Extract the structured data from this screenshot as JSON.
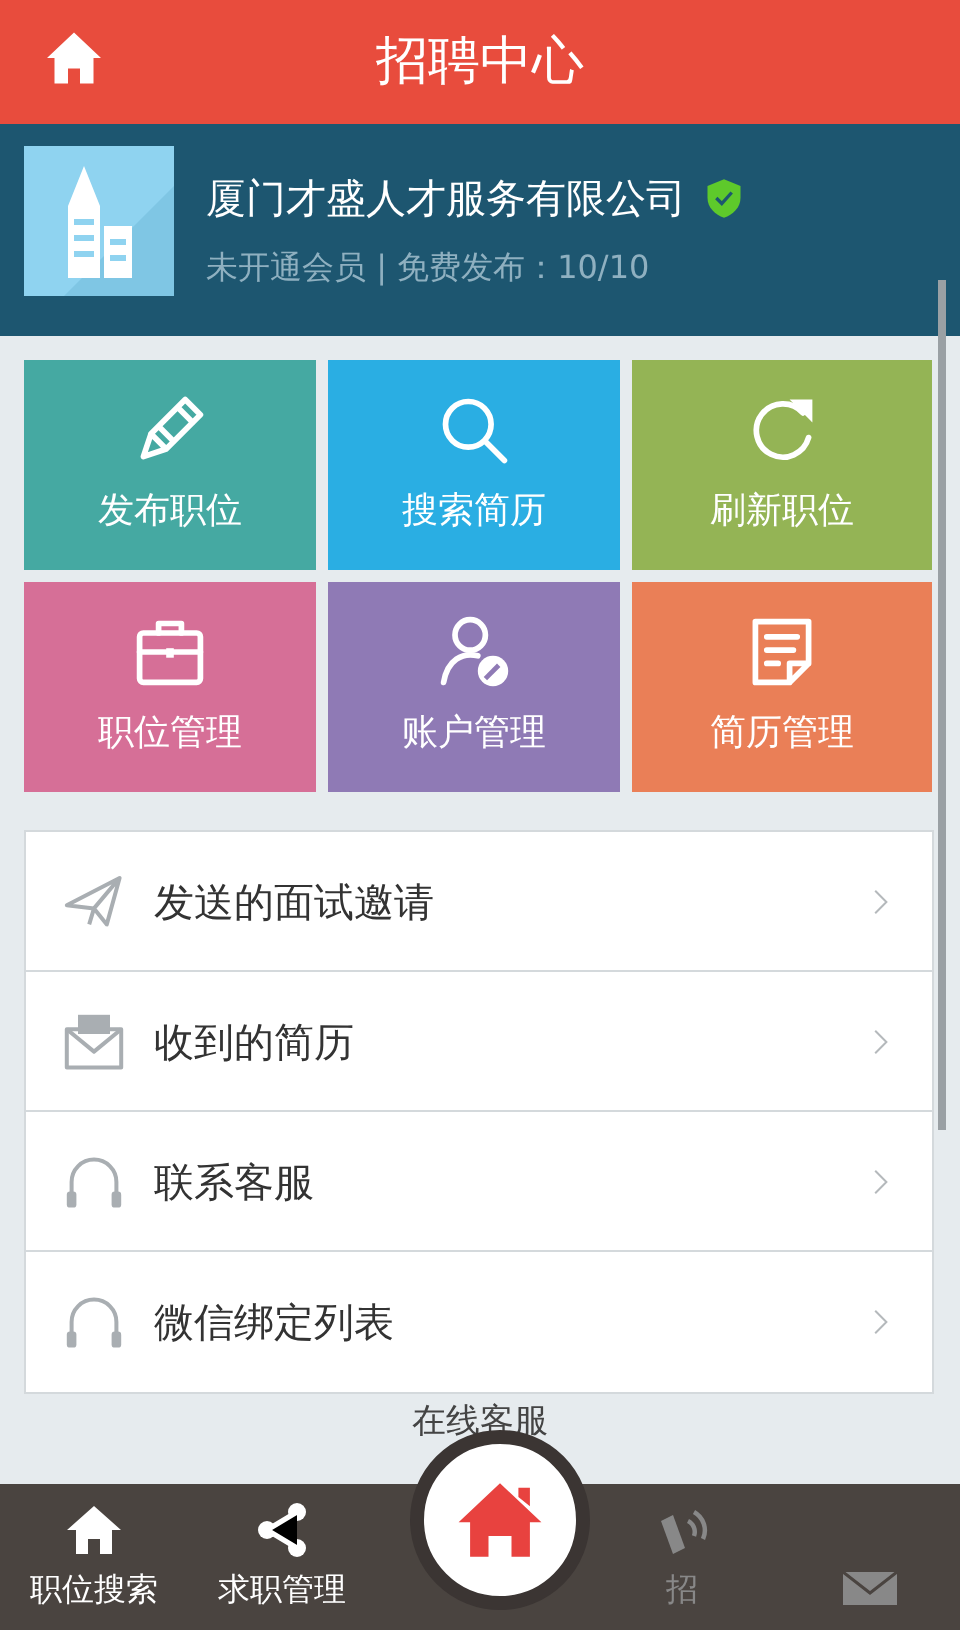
{
  "header": {
    "title": "招聘中心"
  },
  "company": {
    "name": "厦门才盛人才服务有限公司",
    "verified": true,
    "status": "未开通会员 | 免费发布：10/10"
  },
  "tiles": [
    {
      "label": "发布职位",
      "kind": "pencil",
      "color": "#45a9a2"
    },
    {
      "label": "搜索简历",
      "kind": "search",
      "color": "#2aaee3"
    },
    {
      "label": "刷新职位",
      "kind": "refresh",
      "color": "#94b455"
    },
    {
      "label": "职位管理",
      "kind": "briefcase",
      "color": "#d66f97"
    },
    {
      "label": "账户管理",
      "kind": "user",
      "color": "#8f7ab5"
    },
    {
      "label": "简历管理",
      "kind": "document",
      "color": "#ea7f57"
    }
  ],
  "menu": [
    {
      "label": "发送的面试邀请",
      "kind": "plane"
    },
    {
      "label": "收到的简历",
      "kind": "mail"
    },
    {
      "label": "联系客服",
      "kind": "headset"
    },
    {
      "label": "微信绑定列表",
      "kind": "headset"
    }
  ],
  "section_label": "在线客服",
  "bottom_nav": [
    {
      "label": "职位搜索",
      "kind": "home"
    },
    {
      "label": "求职管理",
      "kind": "share"
    },
    {
      "kind": "center"
    },
    {
      "label": "招",
      "kind": "signal"
    },
    {
      "kind": "mail"
    }
  ]
}
